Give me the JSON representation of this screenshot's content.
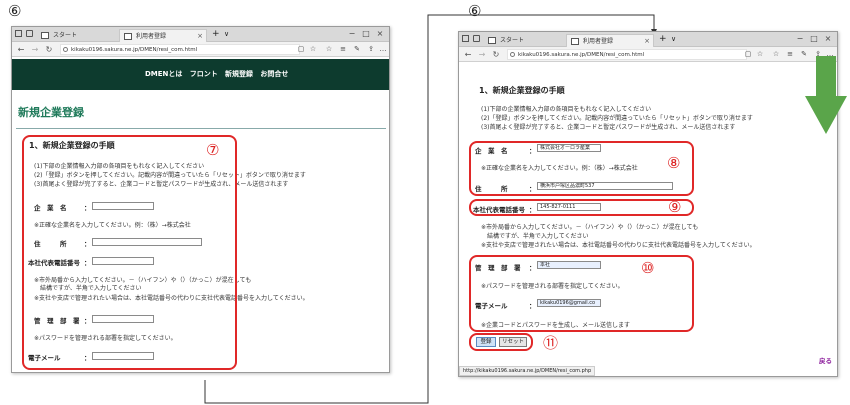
{
  "step_markers": {
    "left": "⑥",
    "right": "⑥"
  },
  "callouts": {
    "c7": "⑦",
    "c8": "⑧",
    "c9": "⑨",
    "c10": "⑩",
    "c11": "⑪"
  },
  "browser": {
    "tab_start": "スタート",
    "tab_user_reg": "利用者登録",
    "new_tab": "+",
    "tab_menu": "∨",
    "url": "kikaku0196.sakura.ne.jp/DMEN/resi_com.html",
    "status_url": "http://kikaku0196.sakura.ne.jp/DMEN/resi_com.php",
    "minimize": "−",
    "maximize": "□",
    "close": "×"
  },
  "site_nav": {
    "title_prefix": "DMENとは",
    "items": [
      "フロント",
      "新規登録",
      "お問合せ"
    ]
  },
  "page_title": "新規企業登録",
  "section": {
    "heading": "1、新規企業登録の手順",
    "instructions": [
      "(1)下部の企業情報入力部の各項目をもれなく記入してください",
      "(2)「登録」ボタンを押してください。記載内容が間違っていたら「リセット」ボタンで取り消せます",
      "(3)首尾よく登録が完了すると、企業コードと暫定パスワードが生成され、メール送信されます"
    ]
  },
  "form": {
    "company_name_label": "企　業　名",
    "company_name_value": "株式会社オーロラ産業",
    "company_name_note": "※正確な企業名を入力してください。例：（株）→株式会社",
    "address_label": "住　　　所",
    "address_value": "横浜市戸塚区品濃町537",
    "phone_label": "本社代表電話番号",
    "phone_value": "145-827-0111",
    "phone_note1": "※市外局番から入力してください。－（ハイフン）や（）（かっこ）が混在しても",
    "phone_note2": "　結構ですが、半角で入力してください",
    "phone_note3": "※支社や支店で管理されたい場合は、本社電話番号の代わりに支社代表電話番号を入力してください。",
    "dept_label": "管　理　部　署",
    "dept_value": "本社",
    "dept_note": "※パスワードを管理される部署を指定してください。",
    "email_label": "電子メール",
    "email_value": "kikaku0196@gmail.co",
    "email_note": "※企業コードとパスワードを生成し、メール送信します",
    "colon": "：",
    "submit_label": "登録",
    "reset_label": "リセット",
    "back_link": "戻る"
  },
  "colors": {
    "callout_border": "#e02828",
    "site_header_bg": "#0d3b2e",
    "title_green": "#1f7a5a",
    "arrow_green": "#5aa54a",
    "back_link": "#8a1a9a"
  }
}
